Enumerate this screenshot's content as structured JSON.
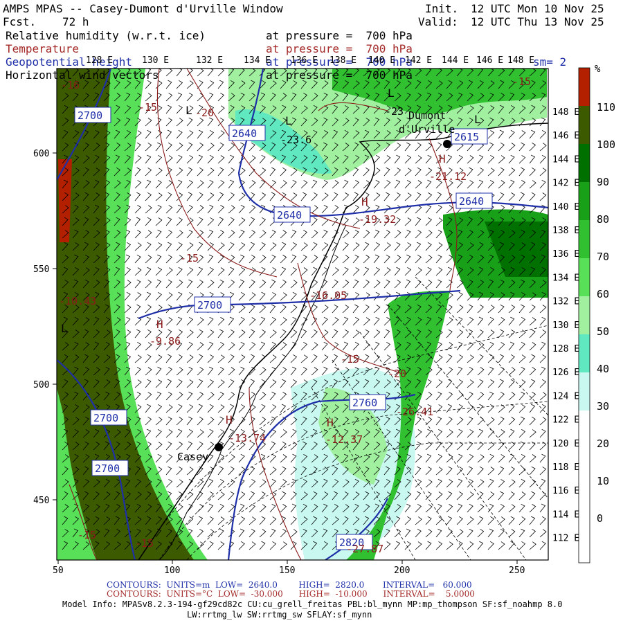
{
  "header": {
    "title": "AMPS MPAS -- Casey-Dumont d'Urville Window",
    "forecast_label": "Fcst.",
    "forecast_hours": "72 h",
    "init_label": "Init.",
    "init_time": "12 UTC Mon 10 Nov 25",
    "valid_label": "Valid:",
    "valid_time": "12 UTC Thu 13 Nov 25",
    "fields": [
      {
        "name": "Relative humidity (w.r.t. ice)",
        "level": "at pressure =  700 hPa",
        "color": "#000000"
      },
      {
        "name": "Temperature",
        "level": "at pressure =  700 hPa",
        "color": "#a52a2a"
      },
      {
        "name": "Geopotential height",
        "level": "at pressure =  700 hPa",
        "color": "#1f2fa8"
      },
      {
        "name": "Horizontal wind vectors",
        "level": "at pressure =  700 hPa",
        "color": "#000000"
      }
    ],
    "smoothing": "sm= 2"
  },
  "top_longitudes": [
    "128 E",
    "130 E",
    "132 E",
    "134 E",
    "136 E",
    "138 E",
    "140 E",
    "142 E",
    "144 E",
    "146 E",
    "148 E"
  ],
  "right_longitudes": [
    "148 E",
    "146 E",
    "144 E",
    "142 E",
    "140 E",
    "138 E",
    "136 E",
    "134 E",
    "132 E",
    "130 E",
    "128 E",
    "126 E",
    "124 E",
    "122 E",
    "120 E",
    "118 E",
    "116 E",
    "114 E",
    "112 E"
  ],
  "x_ticks": [
    "50",
    "100",
    "150",
    "200",
    "250"
  ],
  "y_ticks": [
    "600",
    "550",
    "500",
    "450"
  ],
  "colorbar": {
    "unit": "%",
    "labels": [
      "110",
      "100",
      "90",
      "80",
      "70",
      "60",
      "50",
      "40",
      "30",
      "20",
      "10",
      "0"
    ],
    "colors": [
      "#b22000",
      "#3c5a00",
      "#007000",
      "#18a018",
      "#30c030",
      "#58e058",
      "#a0f0a0",
      "#60e8c0",
      "#c8f8f0"
    ]
  },
  "map_labels": {
    "stations": [
      "Dumont",
      "d'Urville",
      "Casey"
    ],
    "height_labels": [
      "2700",
      "2640",
      "2640",
      "2640",
      "2700",
      "2700",
      "2700",
      "2760",
      "2820",
      "2615"
    ],
    "temp_labels": [
      "-15",
      "-20",
      "-15",
      "-15",
      "-20",
      "-15",
      "-15",
      "-15"
    ],
    "highs": [
      "H",
      "H",
      "H",
      "H",
      "H"
    ],
    "lows": [
      "L",
      "L",
      "L",
      "L",
      "L"
    ],
    "values": [
      "-23.6",
      "-23",
      "-21.12",
      "-19.32",
      "-16.05",
      "-9.86",
      "-10.43",
      "-12.37",
      "-26.41",
      "-13.74",
      "-27.87",
      "-16"
    ]
  },
  "footer": {
    "contours1": "CONTOURS:  UNITS=m  LOW=  2640.0        HIGH=  2820.0       INTERVAL=   60.000",
    "contours2": "CONTOURS:  UNITS=°C  LOW=  -30.000      HIGH=  -10.000      INTERVAL=    5.0000",
    "model1": "Model Info: MPASv8.2.3-194-gf29cd82c CU:cu_grell_freitas PBL:bl_mynn MP:mp_thompson SF:sf_noahmp 8.0",
    "model2": "LW:rrtmg_lw SW:rrtmg_sw SFLAY:sf_mynn"
  }
}
